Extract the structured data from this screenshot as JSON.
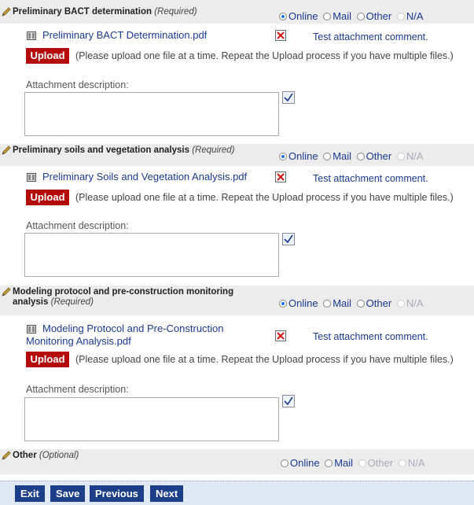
{
  "radio_labels": [
    "Online",
    "Mail",
    "Other",
    "N/A"
  ],
  "upload_label": "Upload",
  "upload_note": "(Please upload one file at a time. Repeat the Upload process if you have multiple files.)",
  "desc_label": "Attachment description:",
  "sections": [
    {
      "title": "Preliminary BACT determination",
      "req": "(Required)",
      "selected": "Online",
      "file_line1": "Preliminary BACT Determination.pdf",
      "comment": "Test attachment comment."
    },
    {
      "title": "Preliminary soils and vegetation analysis",
      "req": "(Required)",
      "selected": "Online",
      "file_line1": "Preliminary Soils and Vegetation Analysis.pdf",
      "comment": "Test attachment comment."
    },
    {
      "title_line1": "Modeling protocol and pre-construction monitoring",
      "title_line2": "analysis",
      "req": "(Required)",
      "selected": "Online",
      "file_line1": "Modeling Protocol and Pre-Construction",
      "file_line2": "Monitoring Analysis.pdf",
      "comment": "Test attachment comment."
    },
    {
      "title": "Other",
      "req": "(Optional)",
      "selected": "none"
    }
  ],
  "nav": {
    "exit": "Exit",
    "save": "Save",
    "previous": "Previous",
    "next": "Next"
  },
  "colors": {
    "link": "#1a3a8f",
    "upload": "#b50a0a",
    "nav_button": "#1d3f8a",
    "header_bg": "#ececec"
  }
}
